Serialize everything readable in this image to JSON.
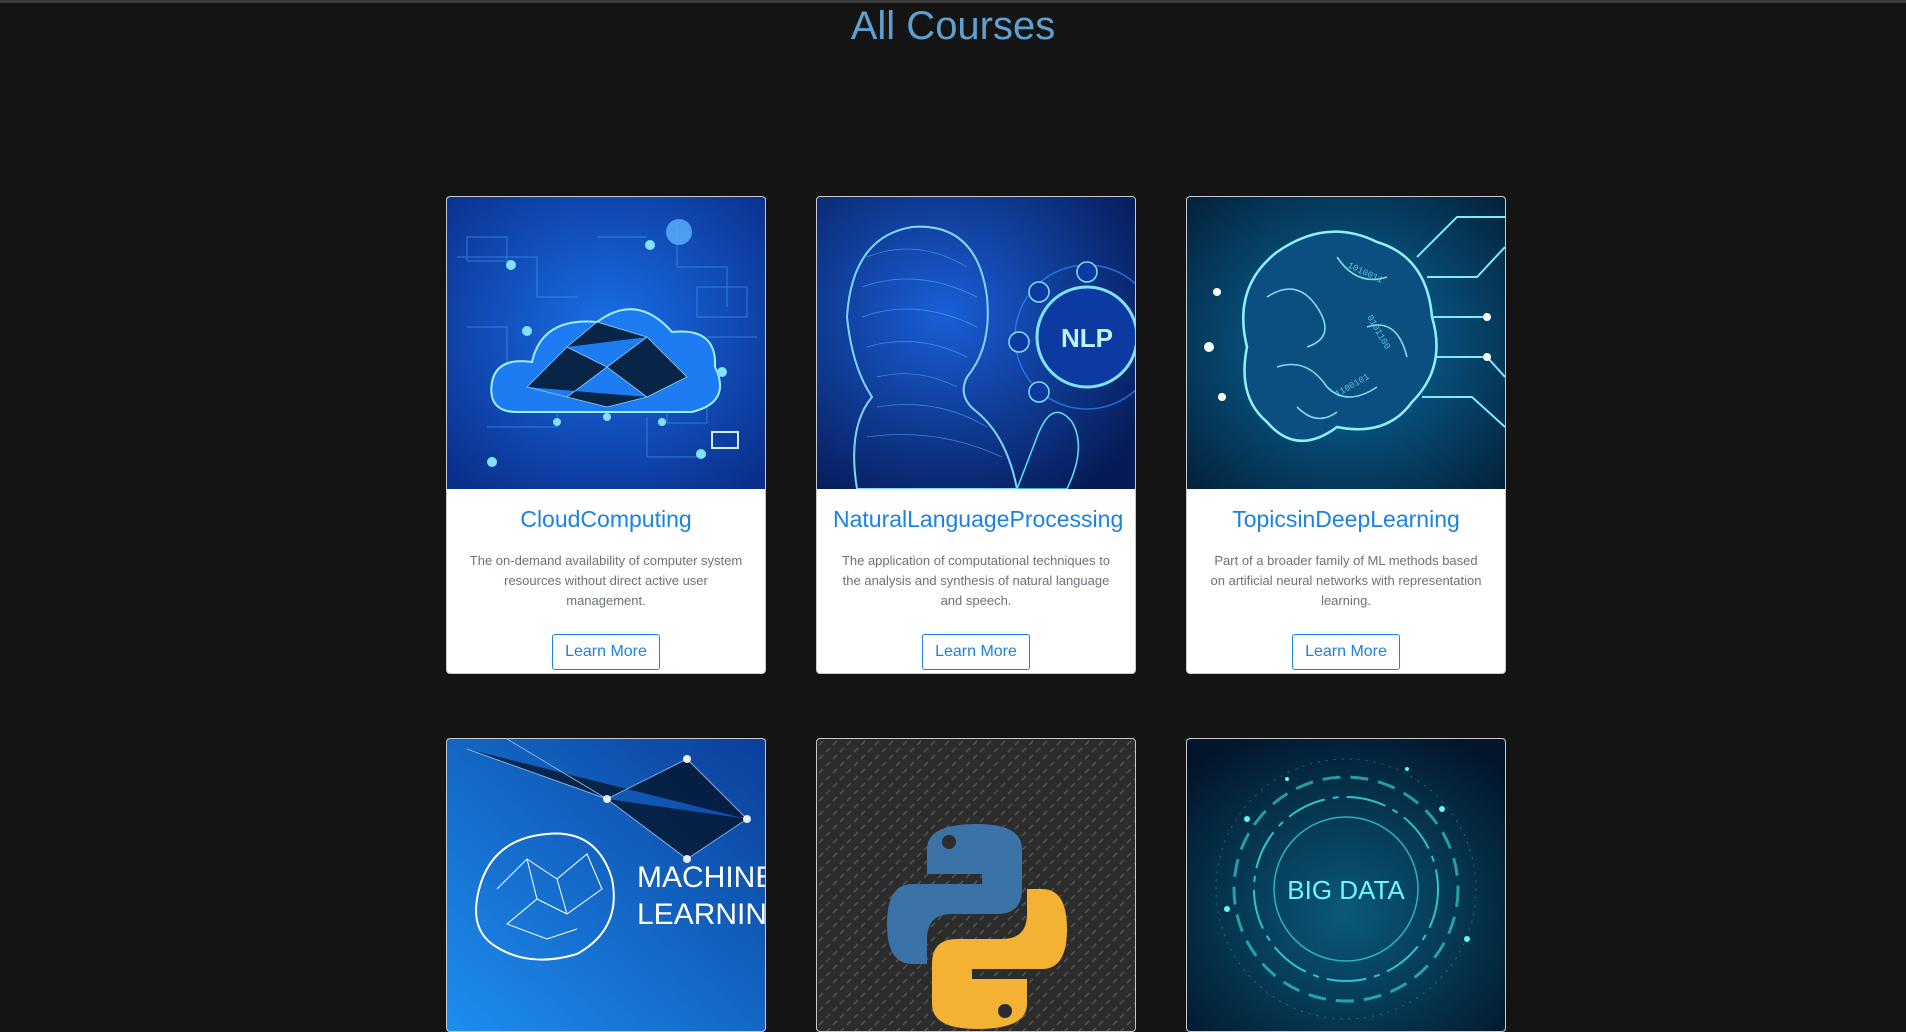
{
  "page": {
    "title": "All Courses"
  },
  "courses": [
    {
      "title": "CloudComputing",
      "description": "The on-demand availability of computer system resources without direct active user management.",
      "button": "Learn More",
      "image_icon": "cloud-computing-image",
      "colors": [
        "#0a2f8c",
        "#1a6fe8",
        "#7fe3ff"
      ]
    },
    {
      "title": "NaturalLanguageProcessing",
      "description": "The application of computational techniques to the analysis and synthesis of natural language and speech.",
      "button": "Learn More",
      "image_icon": "nlp-robot-head-image",
      "image_text": "NLP",
      "colors": [
        "#061a55",
        "#1a5fd8",
        "#8fe6ff"
      ]
    },
    {
      "title": "TopicsinDeepLearning",
      "description": "Part of a broader family of ML methods based on artificial neural networks with representation learning.",
      "button": "Learn More",
      "image_icon": "brain-circuit-image",
      "colors": [
        "#03223a",
        "#0b6fa8",
        "#8ff3ff"
      ]
    },
    {
      "title": "",
      "image_icon": "machine-learning-image",
      "image_text": [
        "MACHINE",
        "LEARNING"
      ],
      "colors": [
        "#0b3f9a",
        "#1d8ef0",
        "#ffffff"
      ]
    },
    {
      "title": "",
      "image_icon": "python-logo-image",
      "colors": [
        "#2c2c2c",
        "#3b73a8",
        "#f3b233"
      ]
    },
    {
      "title": "",
      "image_icon": "big-data-image",
      "image_text": "BIG DATA",
      "colors": [
        "#02152a",
        "#0a5a7a",
        "#39e6e6"
      ]
    }
  ]
}
